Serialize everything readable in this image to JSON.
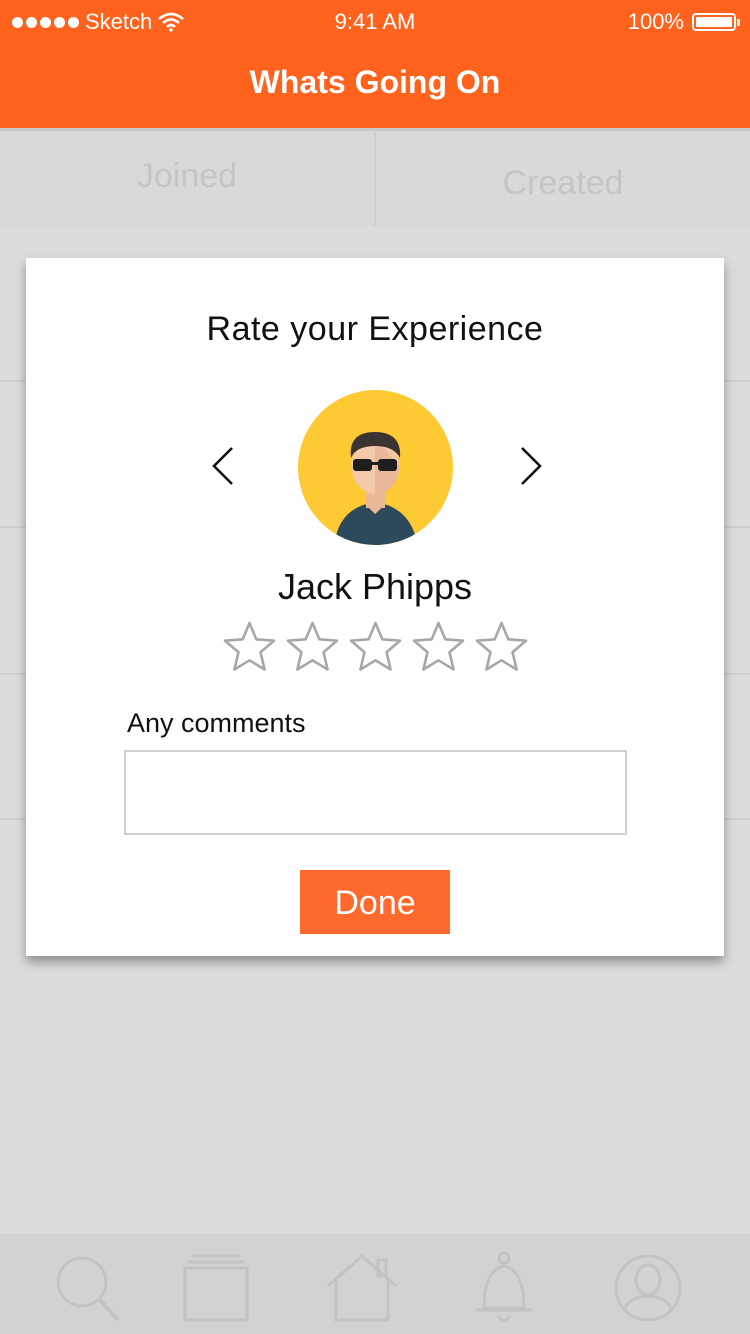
{
  "status_bar": {
    "carrier": "Sketch",
    "time": "9:41 AM",
    "battery": "100%"
  },
  "header": {
    "title": "Whats Going On"
  },
  "tabs": [
    {
      "label": "Joined"
    },
    {
      "label": "Created"
    }
  ],
  "modal": {
    "title": "Rate your Experience",
    "person_name": "Jack Phipps",
    "rating": 0,
    "max_rating": 5,
    "comments_label": "Any comments",
    "comments_value": "",
    "done_label": "Done"
  },
  "bottom_tabbar": {
    "icons": [
      "search-icon",
      "cards-icon",
      "home-icon",
      "bell-icon",
      "profile-icon"
    ]
  },
  "colors": {
    "accent": "#fe621d",
    "button": "#fe6a2d",
    "avatar_bg": "#fdca34"
  }
}
